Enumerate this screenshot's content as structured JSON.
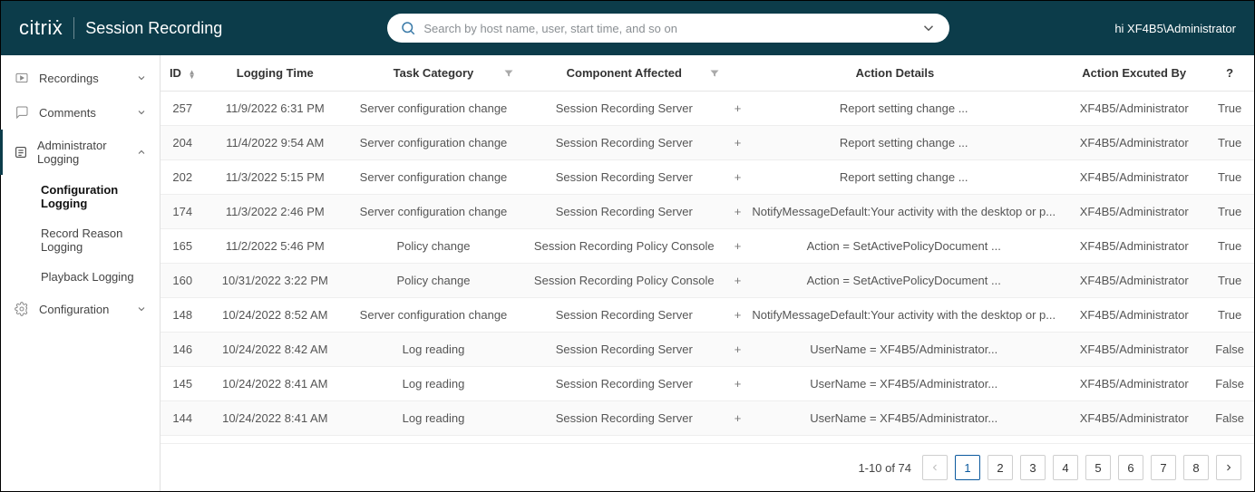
{
  "header": {
    "brand_logo_text": "citriẋ",
    "product_name": "Session Recording",
    "search_placeholder": "Search by host name, user, start time, and so on",
    "user_greeting": "hi XF4B5\\Administrator"
  },
  "sidebar": {
    "items": [
      {
        "icon": "play",
        "label": "Recordings",
        "expanded": false
      },
      {
        "icon": "comment",
        "label": "Comments",
        "expanded": false
      },
      {
        "icon": "list",
        "label": "Administrator Logging",
        "expanded": true,
        "children": [
          {
            "label": "Configuration Logging",
            "active": true
          },
          {
            "label": "Record Reason Logging",
            "active": false
          },
          {
            "label": "Playback Logging",
            "active": false
          }
        ]
      },
      {
        "icon": "gear",
        "label": "Configuration",
        "expanded": false
      }
    ]
  },
  "table": {
    "columns": {
      "id": "ID",
      "logging_time": "Logging Time",
      "task_category": "Task Category",
      "component_affected": "Component Affected",
      "action_details": "Action Details",
      "action_executed_by": "Action Excuted By",
      "question": "?"
    },
    "rows": [
      {
        "id": "257",
        "time": "11/9/2022 6:31 PM",
        "cat": "Server configuration change",
        "comp": "Session Recording Server",
        "action": "Report setting change ...",
        "by": "XF4B5/Administrator",
        "q": "True"
      },
      {
        "id": "204",
        "time": "11/4/2022 9:54 AM",
        "cat": "Server configuration change",
        "comp": "Session Recording Server",
        "action": "Report setting change ...",
        "by": "XF4B5/Administrator",
        "q": "True"
      },
      {
        "id": "202",
        "time": "11/3/2022 5:15 PM",
        "cat": "Server configuration change",
        "comp": "Session Recording Server",
        "action": "Report setting change ...",
        "by": "XF4B5/Administrator",
        "q": "True"
      },
      {
        "id": "174",
        "time": "11/3/2022 2:46 PM",
        "cat": "Server configuration change",
        "comp": "Session Recording Server",
        "action": "NotifyMessageDefault:Your activity with the desktop or p...",
        "by": "XF4B5/Administrator",
        "q": "True"
      },
      {
        "id": "165",
        "time": "11/2/2022 5:46 PM",
        "cat": "Policy change",
        "comp": "Session Recording Policy Console",
        "action": "Action = SetActivePolicyDocument ...",
        "by": "XF4B5/Administrator",
        "q": "True"
      },
      {
        "id": "160",
        "time": "10/31/2022 3:22 PM",
        "cat": "Policy change",
        "comp": "Session Recording Policy Console",
        "action": "Action = SetActivePolicyDocument ...",
        "by": "XF4B5/Administrator",
        "q": "True"
      },
      {
        "id": "148",
        "time": "10/24/2022 8:52 AM",
        "cat": "Server configuration change",
        "comp": "Session Recording Server",
        "action": "NotifyMessageDefault:Your activity with the desktop or p...",
        "by": "XF4B5/Administrator",
        "q": "True"
      },
      {
        "id": "146",
        "time": "10/24/2022 8:42 AM",
        "cat": "Log reading",
        "comp": "Session Recording Server",
        "action": "UserName = XF4B5/Administrator...",
        "by": "XF4B5/Administrator",
        "q": "False"
      },
      {
        "id": "145",
        "time": "10/24/2022 8:41 AM",
        "cat": "Log reading",
        "comp": "Session Recording Server",
        "action": "UserName = XF4B5/Administrator...",
        "by": "XF4B5/Administrator",
        "q": "False"
      },
      {
        "id": "144",
        "time": "10/24/2022 8:41 AM",
        "cat": "Log reading",
        "comp": "Session Recording Server",
        "action": "UserName = XF4B5/Administrator...",
        "by": "XF4B5/Administrator",
        "q": "False"
      }
    ]
  },
  "pagination": {
    "range_label": "1-10 of 74",
    "pages": [
      "1",
      "2",
      "3",
      "4",
      "5",
      "6",
      "7",
      "8"
    ],
    "current": "1"
  }
}
